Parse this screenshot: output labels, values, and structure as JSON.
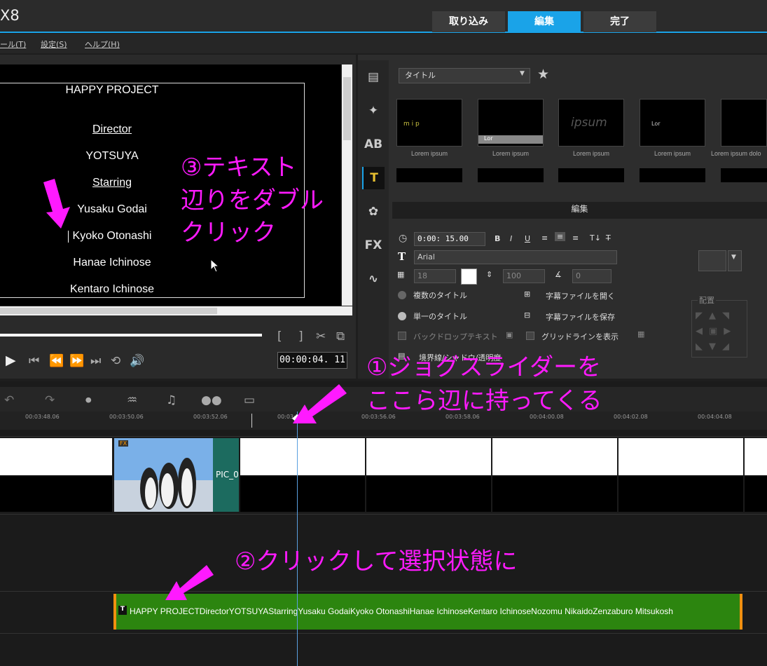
{
  "app": {
    "title": "X8"
  },
  "mode_tabs": [
    "取り込み",
    "編集",
    "完了"
  ],
  "menu": [
    "ール(T)",
    "設定(S)",
    "ヘルプ(H)"
  ],
  "preview": {
    "lines": [
      "HAPPY PROJECT",
      "Director",
      "YOTSUYA",
      "Starring",
      "Yusaku Godai",
      "Kyoko Otonashi",
      "Hanae Ichinose",
      "Kentaro Ichinose"
    ],
    "timecode": "00:00:04. 11"
  },
  "library": {
    "category": "タイトル",
    "thumb_labels": [
      "Lorem ipsum",
      "Lorem ipsum",
      "Lorem ipsum",
      "Lorem ipsum",
      "Lorem ipsum dolo"
    ],
    "thumb_texts": [
      "m   i   p",
      "Lor",
      "ipsum",
      "Lor"
    ]
  },
  "edit_panel": {
    "tab": "編集",
    "duration": "0:00: 15.00",
    "font": "Arial",
    "size": "18",
    "line_spacing": "100",
    "angle": "0",
    "multi_title": "複数のタイトル",
    "single_title": "単一のタイトル",
    "open_subtitle": "字幕ファイルを開く",
    "save_subtitle": "字幕ファイルを保存",
    "backdrop": "バックドロップテキスト",
    "gridline": "グリッドラインを表示",
    "border": "境界線/シャドウ/透明度",
    "align_label": "配置"
  },
  "timeline": {
    "ticks": [
      "00:03:48.06",
      "00:03:50.06",
      "00:03:52.06",
      "00:03:54.06",
      "00:03:56.06",
      "00:03:58.06",
      "00:04:00.08",
      "00:04:02.08",
      "00:04:04.08"
    ],
    "photo_clip": "PIC_0",
    "fx_badge": "FX",
    "title_clip": "HAPPY PROJECTDirectorYOTSUYAStarringYusaku GodaiKyoko OtonashiHanae IchinoseKentaro IchinoseNozomu NikaidoZenzaburo Mitsukosh"
  },
  "annotations": {
    "step1_a": "①ジョグスライダーを",
    "step1_b": "ここら辺に持ってくる",
    "step2": "②クリックして選択状態に",
    "step3_a": "③テキスト",
    "step3_b": "辺りをダブル",
    "step3_c": "クリック"
  },
  "colors": {
    "accent": "#1aa3e8",
    "annotation": "#ff1aff",
    "title_clip": "#2c850f"
  }
}
